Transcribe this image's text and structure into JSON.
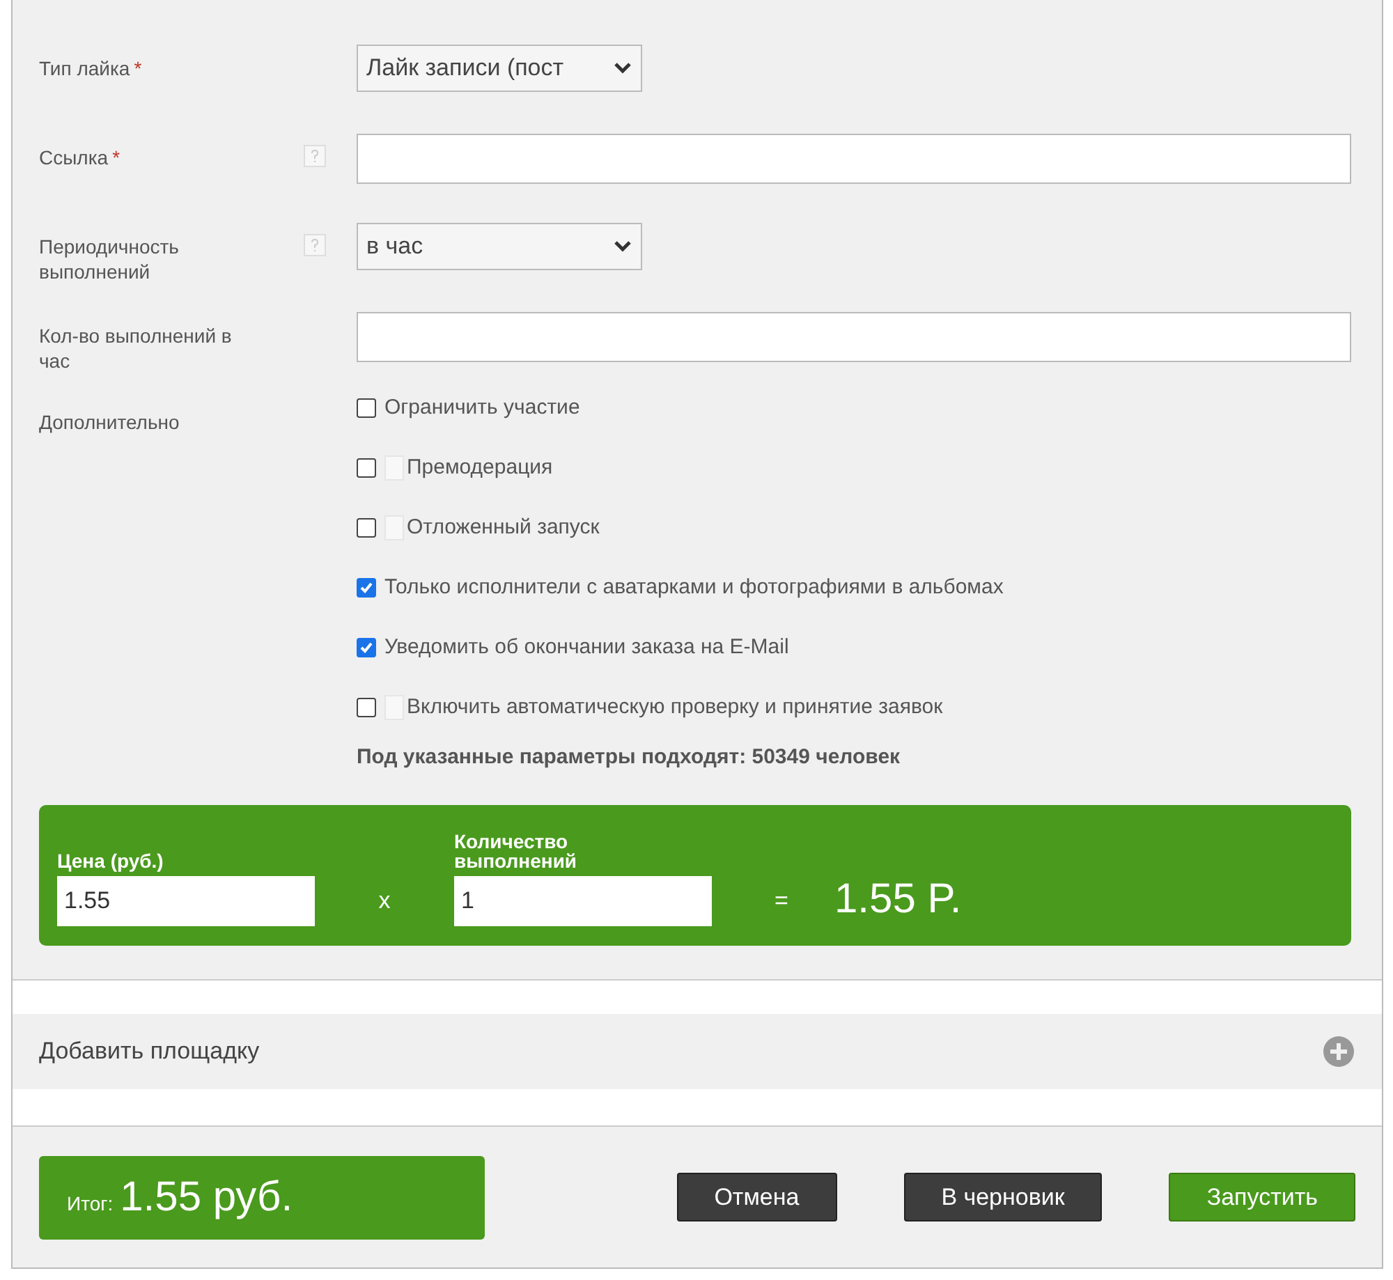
{
  "fields": [
    {
      "label": "Тип лайка",
      "required_mark": "*",
      "help": false,
      "kind": "select",
      "value": "Лайк записи (пост"
    },
    {
      "label": "Ссылка",
      "required_mark": "*",
      "help": true,
      "kind": "input"
    },
    {
      "label": "Периодичность выполнений",
      "help": true,
      "kind": "select",
      "value": "в час"
    },
    {
      "label": "Кол-во выполнений в час",
      "help": false,
      "kind": "input"
    }
  ],
  "extra": {
    "label": "Дополнительно",
    "options": [
      {
        "label": "Ограничить участие",
        "checked": false,
        "help": false
      },
      {
        "label": "Премодерация",
        "checked": false,
        "help": true
      },
      {
        "label": "Отложенный запуск",
        "checked": false,
        "help": true
      },
      {
        "label": "Только исполнители с аватарками и фотографиями в альбомах",
        "checked": true,
        "help": false
      },
      {
        "label": "Уведомить об окончании заказа на E-Mail",
        "checked": true,
        "help": false
      },
      {
        "label": "Включить автоматическую проверку и принятие заявок",
        "checked": false,
        "help": true
      }
    ]
  },
  "match_text": "Под указанные параметры подходят: 50349 человек",
  "calc": {
    "price_label": "Цена (руб.)",
    "price_value": "1.55",
    "times": "x",
    "qty_label": "Количество выполнений",
    "qty_value": "1",
    "equals": "=",
    "total": "1.55 P."
  },
  "add_platform": {
    "label": "Добавить площадку"
  },
  "footer": {
    "total_label": "Итог:",
    "total_value": "1.55 руб.",
    "buttons": [
      {
        "label": "Отмена",
        "kind": "dark"
      },
      {
        "label": "В черновик",
        "kind": "dark"
      },
      {
        "label": "Запустить",
        "kind": "primary"
      }
    ]
  }
}
